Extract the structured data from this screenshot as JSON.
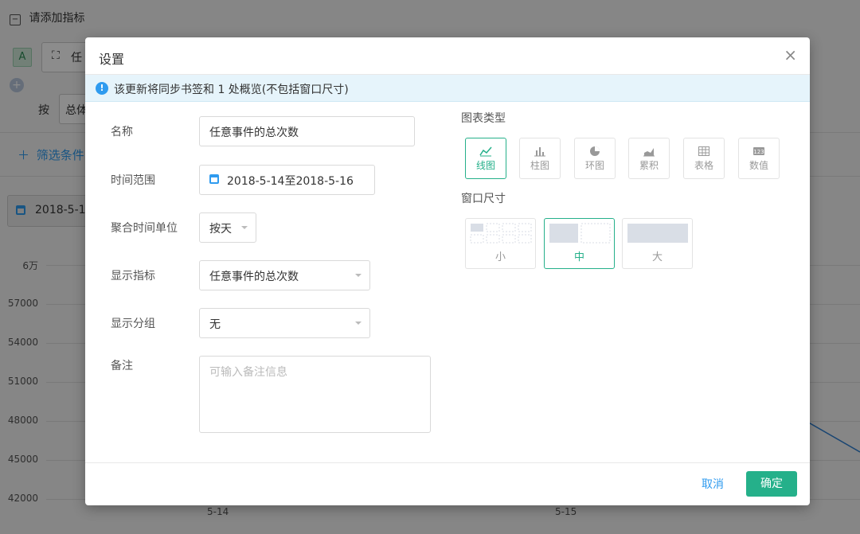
{
  "background": {
    "metric_header": "请添加指标",
    "metric_badge": "A",
    "metric_chip": "任",
    "group_label": "按",
    "group_select": "总体",
    "filter_label": "筛选条件",
    "date_range": "2018-5-1",
    "y_ticks": [
      "6万",
      "57000",
      "54000",
      "51000",
      "48000",
      "45000",
      "42000"
    ],
    "x_ticks": [
      "5-14",
      "5-15"
    ]
  },
  "modal": {
    "title": "设置",
    "close": "×",
    "notice": "该更新将同步书签和 1 处概览(不包括窗口尺寸)",
    "form": {
      "name_label": "名称",
      "name_value": "任意事件的总次数",
      "time_label": "时间范围",
      "time_value": "2018-5-14至2018-5-16",
      "unit_label": "聚合时间单位",
      "unit_value": "按天",
      "metric_label": "显示指标",
      "metric_value": "任意事件的总次数",
      "group_label": "显示分组",
      "group_value": "无",
      "note_label": "备注",
      "note_placeholder": "可输入备注信息"
    },
    "chart_type_title": "图表类型",
    "chart_types": [
      {
        "label": "线图",
        "icon": "line-chart-icon",
        "active": true
      },
      {
        "label": "柱图",
        "icon": "bar-chart-icon",
        "active": false
      },
      {
        "label": "环图",
        "icon": "pie-chart-icon",
        "active": false
      },
      {
        "label": "累积",
        "icon": "area-chart-icon",
        "active": false
      },
      {
        "label": "表格",
        "icon": "table-icon",
        "active": false
      },
      {
        "label": "数值",
        "icon": "number-icon",
        "active": false
      }
    ],
    "window_size_title": "窗口尺寸",
    "window_sizes": [
      {
        "label": "小",
        "active": false
      },
      {
        "label": "中",
        "active": true
      },
      {
        "label": "大",
        "active": false
      }
    ],
    "cancel": "取消",
    "confirm": "确定",
    "accent_color": "#25b08a",
    "link_color": "#2f9bef"
  }
}
